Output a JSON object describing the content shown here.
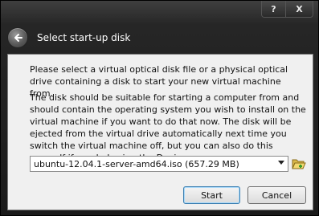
{
  "window": {
    "help_label": "?",
    "close_label": "X",
    "title": "Select start-up disk"
  },
  "content": {
    "intro": "Please select a virtual optical disk file or a physical optical drive containing a disk to start your new virtual machine from.",
    "description": "The disk should be suitable for starting a computer from and should contain the operating system you wish to install on the virtual machine if you want to do that now. The disk will be ejected from the virtual drive automatically next time you switch the virtual machine off, but you can also do this yourself if needed using the Devices menu."
  },
  "disk_select": {
    "value": "ubuntu-12.04.1-server-amd64.iso (657.29 MB)"
  },
  "buttons": {
    "start": "Start",
    "cancel": "Cancel"
  },
  "icons": {
    "back": "back-arrow-icon",
    "folder": "folder-open-icon"
  },
  "colors": {
    "title_bar": "#262626",
    "panel": "#f0f0f0",
    "default_button_border": "#3c7fb1"
  }
}
